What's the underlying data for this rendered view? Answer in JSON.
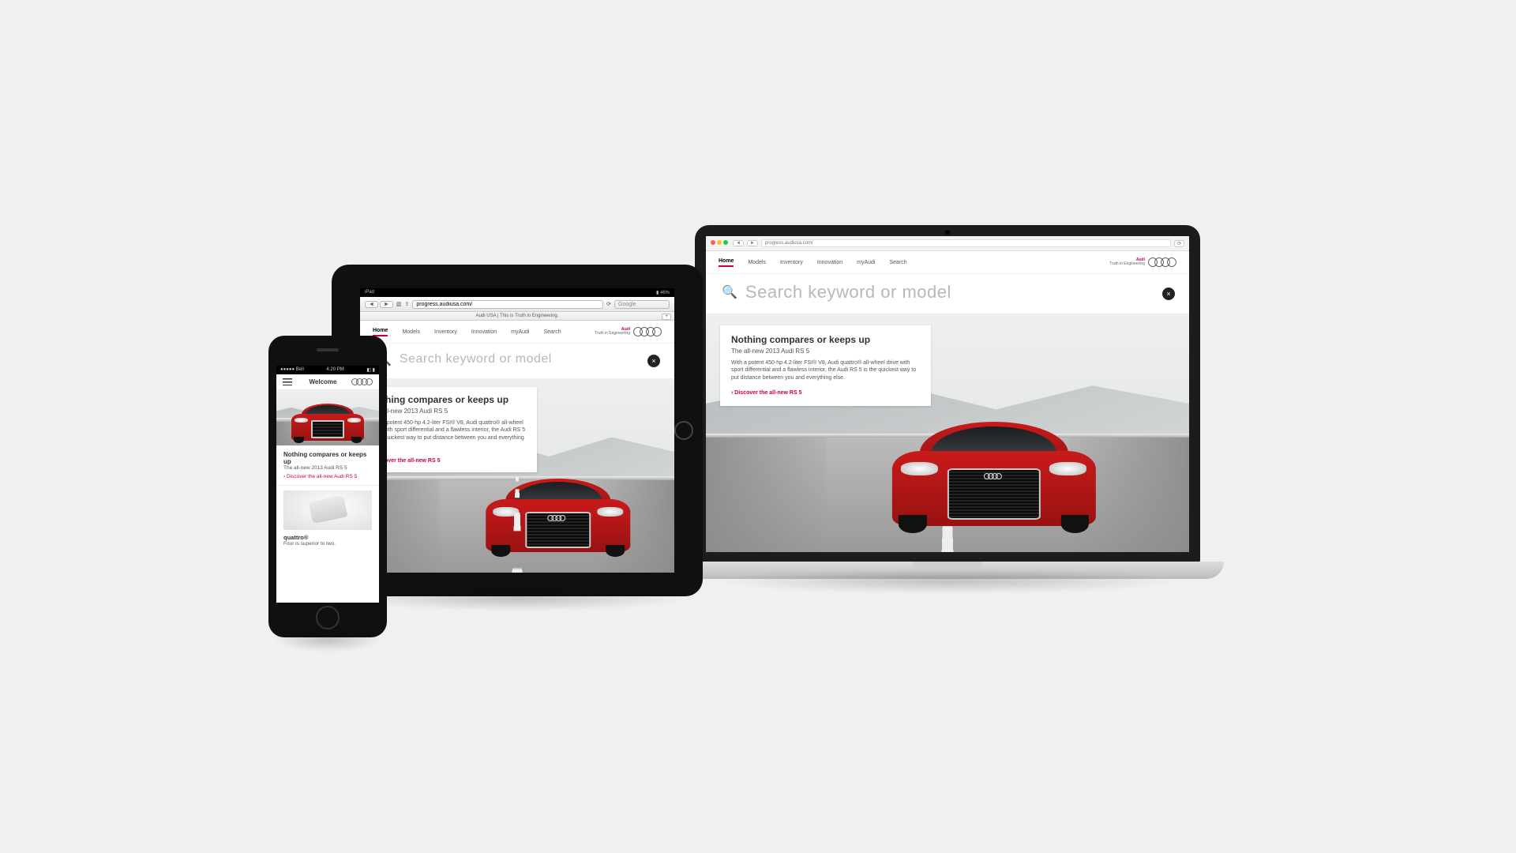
{
  "common": {
    "brand_line1": "Audi",
    "brand_line2": "Truth in Engineering",
    "search_placeholder": "Search keyword or model",
    "close": "×",
    "nav": [
      "Home",
      "Models",
      "Inventory",
      "Innovation",
      "myAudi",
      "Search"
    ],
    "active_nav": "Home"
  },
  "hero": {
    "title": "Nothing compares or keeps up",
    "subtitle": "The all-new 2013 Audi RS 5",
    "body": "With a potent 450-hp 4.2-liter FSI® V8, Audi quattro® all-wheel drive with sport differential and a flawless interior, the Audi RS 5 is the quickest way to put distance between you and everything else.",
    "cta": "Discover the all-new RS 5"
  },
  "laptop": {
    "url": "progress.audiusa.com/"
  },
  "tablet": {
    "status_left": "iPad",
    "status_right": "46%",
    "url": "progress.audiusa.com/",
    "search_hint": "Google",
    "tab_title": "Audi USA | This is Truth in Engineering.",
    "tab_plus": "+"
  },
  "phone": {
    "status_carrier": "●●●●● Bell",
    "status_time": "4:20 PM",
    "welcome": "Welcome",
    "hero_title": "Nothing compares or keeps up",
    "hero_sub": "The all-new 2013 Audi RS 5",
    "hero_cta": "Discover the all-new Audi RS 5",
    "sec2_title": "quattro®",
    "sec2_sub": "Four is superior to two."
  }
}
